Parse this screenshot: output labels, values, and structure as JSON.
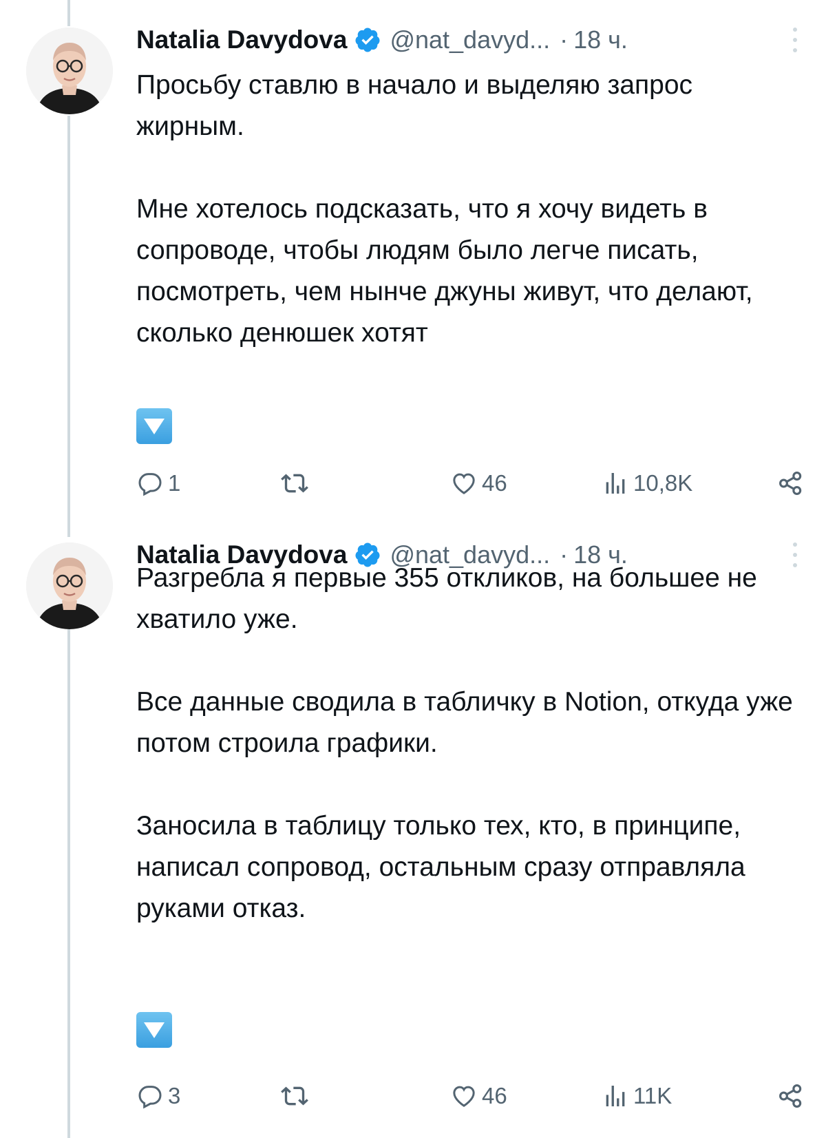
{
  "colors": {
    "text": "#0f1419",
    "secondary": "#536471",
    "verified": "#1d9bf0",
    "thread_line": "#cfd9de"
  },
  "tweets": [
    {
      "display_name": "Natalia Davydova",
      "handle": "@nat_davyd...",
      "separator": "·",
      "time": "18 ч.",
      "paragraphs": [
        "Просьбу ставлю в начало и выделяю запрос жирным.",
        "Мне хотелось подсказать, что я хочу видеть в сопроводе, чтобы людям было легче писать, посмотреть, чем нынче джуны живут, что делают, сколько денюшек хотят"
      ],
      "emoji": "down-arrow-button",
      "actions": {
        "replies": "1",
        "retweets": "",
        "likes": "46",
        "views": "10,8K"
      }
    },
    {
      "display_name": "Natalia Davydova",
      "handle": "@nat_davyd...",
      "separator": "·",
      "time": "18 ч.",
      "paragraphs": [
        "Разгребла я первые 355 откликов, на большее не хватило уже.",
        "Все данные сводила в табличку в Notion, откуда уже потом строила графики.",
        "Заносила в таблицу только тех, кто, в принципе, написал сопровод, остальным сразу отправляла руками отказ."
      ],
      "emoji": "down-arrow-button",
      "actions": {
        "replies": "3",
        "retweets": "",
        "likes": "46",
        "views": "11K"
      }
    }
  ]
}
